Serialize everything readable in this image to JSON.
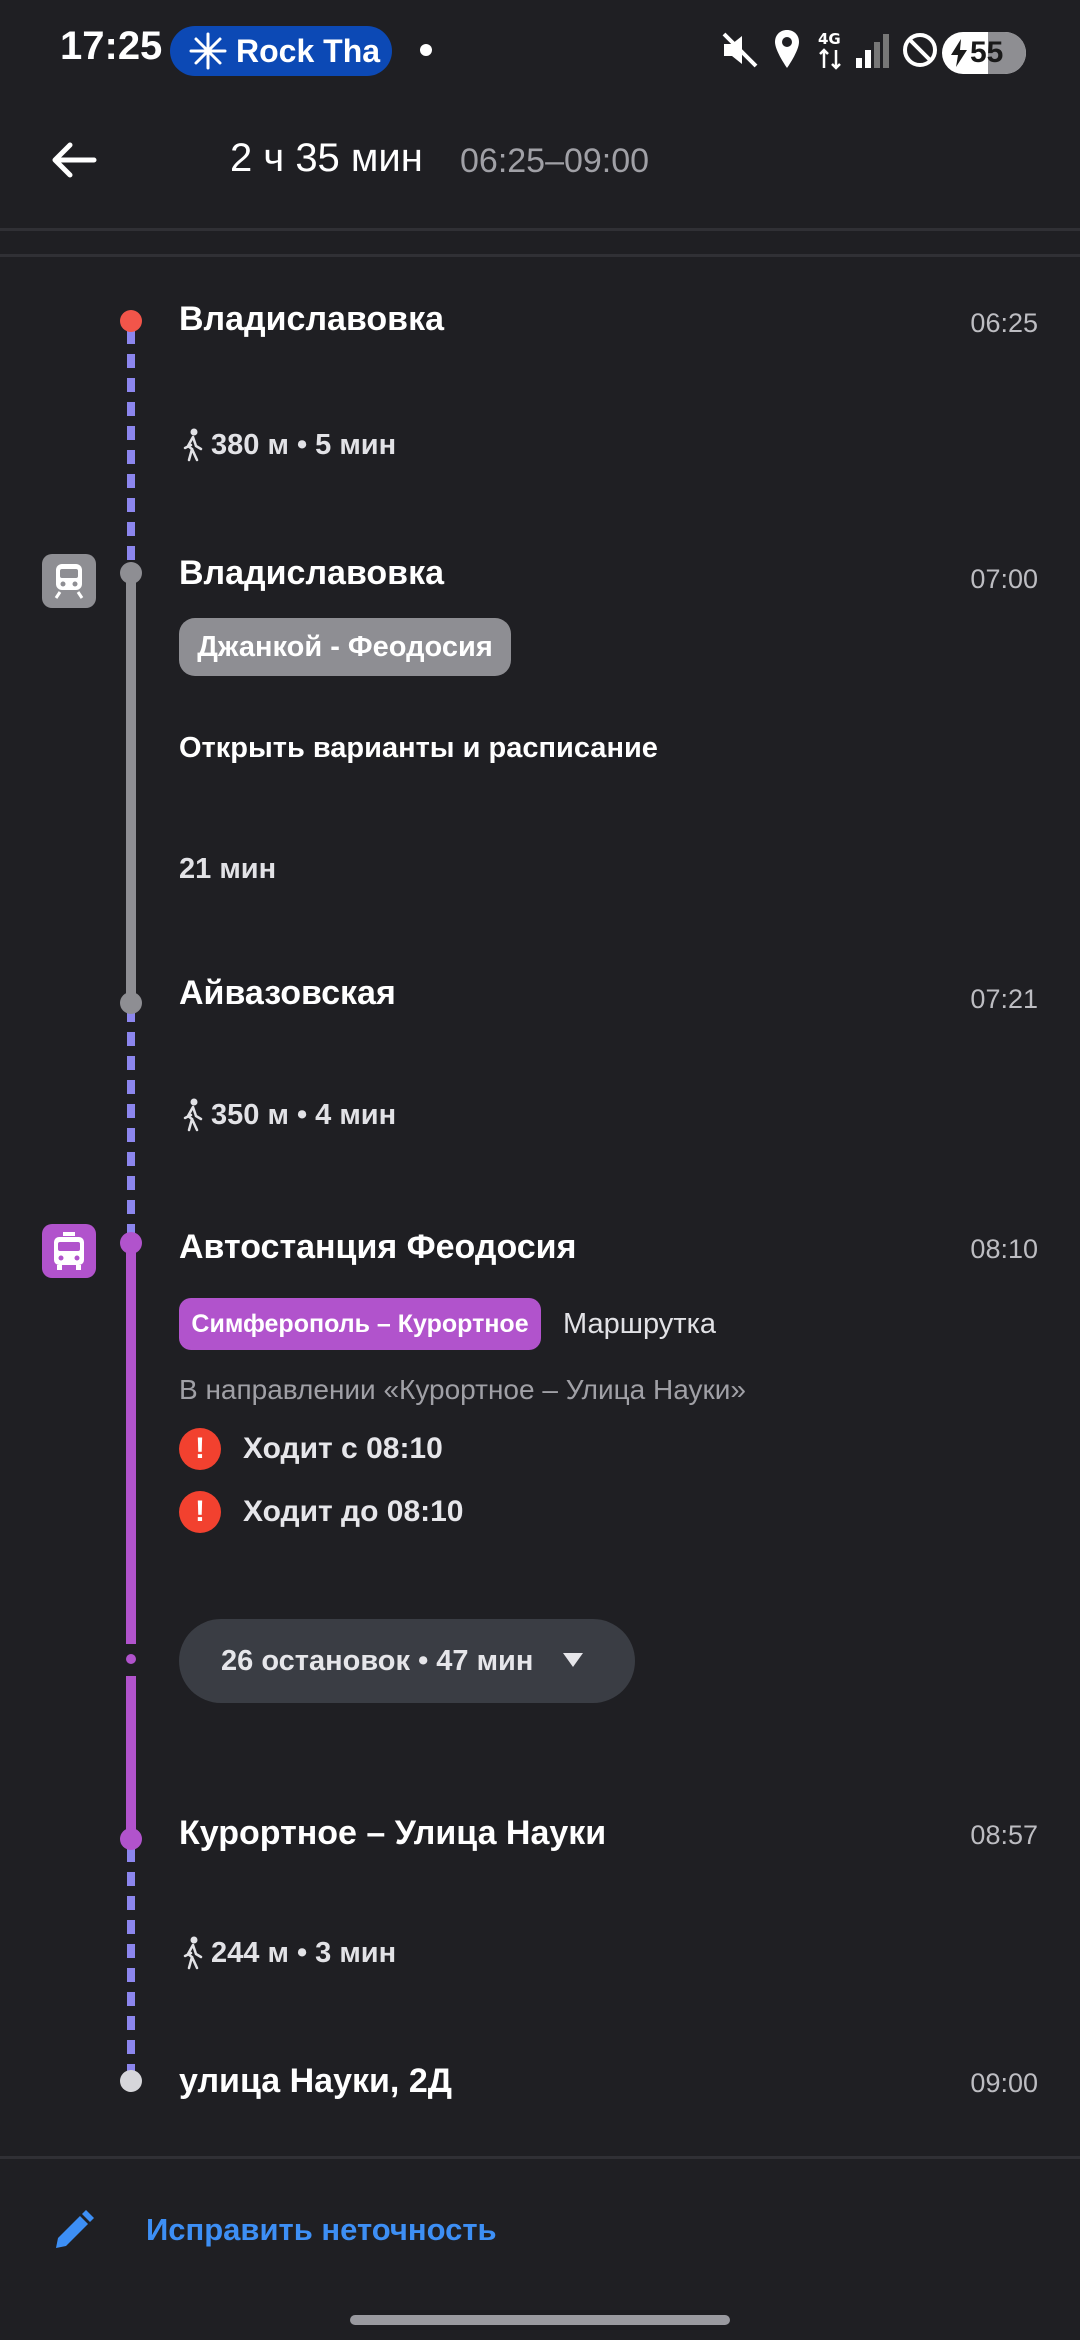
{
  "status_bar": {
    "time": "17:25",
    "media_pill": "Rock Tha",
    "battery_level": "55",
    "network_label": "4G",
    "icons": [
      "mute-icon",
      "location-icon",
      "signal-icon",
      "dnd-icon",
      "battery-icon"
    ]
  },
  "header": {
    "duration": "2 ч 35 мин",
    "time_range": "06:25–09:00"
  },
  "route": {
    "start": {
      "name": "Владиславовка",
      "time": "06:25"
    },
    "walk_1": "380 м • 5 мин",
    "train": {
      "stop_name": "Владиславовка",
      "time": "07:00",
      "route_name": "Джанкой - Феодосия",
      "schedule_link": "Открыть варианты и расписание",
      "duration": "21 мин",
      "end_stop": "Айвазовская",
      "end_time": "07:21"
    },
    "walk_2": "350 м • 4 мин",
    "bus": {
      "stop_name": "Автостанция Феодосия",
      "time": "08:10",
      "route_name": "Симферополь – Курортное",
      "vehicle_type": "Маршрутка",
      "direction": "В направлении «Курортное – Улица Науки»",
      "warning_1": "Ходит с 08:10",
      "warning_2": "Ходит до 08:10",
      "stops_summary": "26 остановок • 47 мин",
      "end_stop": "Курортное – Улица Науки",
      "end_time": "08:57"
    },
    "walk_3": "244 м • 3 мин",
    "finish": {
      "name": "улица Науки, 2Д",
      "time": "09:00"
    }
  },
  "footer": {
    "fix_link": "Исправить неточность"
  },
  "colors": {
    "background": "#1f1f23",
    "walk_line": "#8c86ee",
    "train_line": "#8e8e93",
    "bus_line": "#b153cc",
    "start_node": "#f2554a",
    "link": "#3d8ff5",
    "warning": "#f2412f"
  }
}
